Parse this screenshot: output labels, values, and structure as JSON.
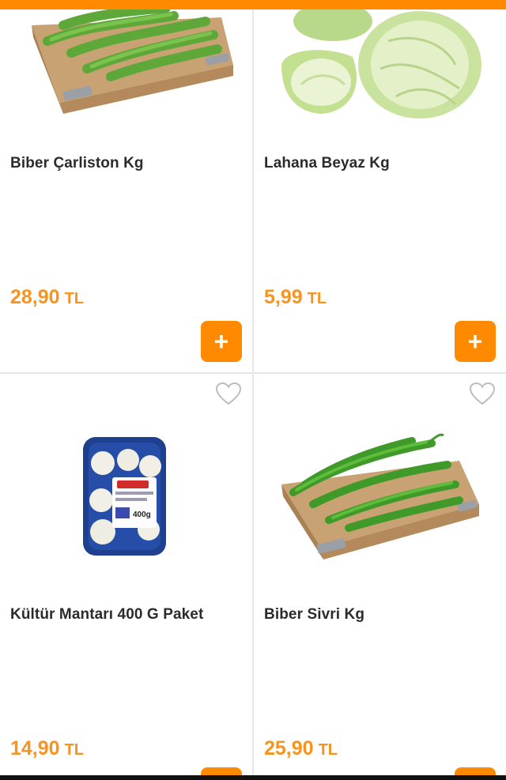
{
  "colors": {
    "accent": "#ff8a00",
    "price": "#f7931e",
    "divider": "#e6e6e6"
  },
  "products": [
    {
      "name": "Biber Çarliston Kg",
      "price": "28,90",
      "currency": "TL",
      "add_label": "+",
      "image_icon": "green-peppers-crate-image"
    },
    {
      "name": "Lahana Beyaz Kg",
      "price": "5,99",
      "currency": "TL",
      "add_label": "+",
      "image_icon": "white-cabbage-image"
    },
    {
      "name": "Kültür Mantarı 400 G Paket",
      "price": "14,90",
      "currency": "TL",
      "add_label": "+",
      "image_icon": "mushroom-pack-image",
      "favorite_icon": "heart-outline-icon"
    },
    {
      "name": "Biber Sivri Kg",
      "price": "25,90",
      "currency": "TL",
      "add_label": "+",
      "image_icon": "green-peppers-crate-image",
      "favorite_icon": "heart-outline-icon"
    }
  ]
}
